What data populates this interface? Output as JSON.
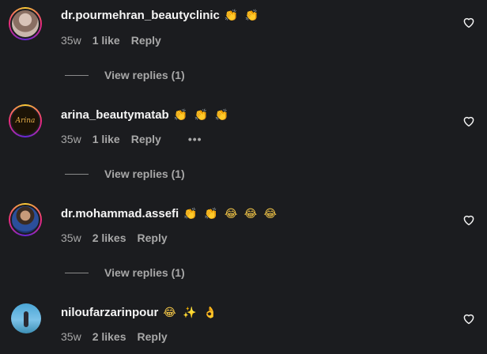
{
  "comments": [
    {
      "username": "dr.pourmehran_beautyclinic",
      "emojis": "👏 👏",
      "time": "35w",
      "likes": "1 like",
      "reply_label": "Reply",
      "view_replies": "View replies (1)"
    },
    {
      "username": "arina_beautymatab",
      "emojis": "👏 👏 👏",
      "time": "35w",
      "likes": "1 like",
      "reply_label": "Reply",
      "more": "•••",
      "view_replies": "View replies (1)",
      "avatar_text": "Arina"
    },
    {
      "username": "dr.mohammad.assefi",
      "emojis": "👏 👏 😂 😂 😂",
      "time": "35w",
      "likes": "2 likes",
      "reply_label": "Reply",
      "view_replies": "View replies (1)"
    },
    {
      "username": "niloufarzarinpour",
      "emojis": "😂 ✨ 👌",
      "time": "35w",
      "likes": "2 likes",
      "reply_label": "Reply"
    }
  ],
  "icons": {
    "like": "heart-outline-icon"
  },
  "colors": {
    "background": "#1b1c1f",
    "primary_text": "#f5f5f5",
    "secondary_text": "#a8a8a8"
  }
}
